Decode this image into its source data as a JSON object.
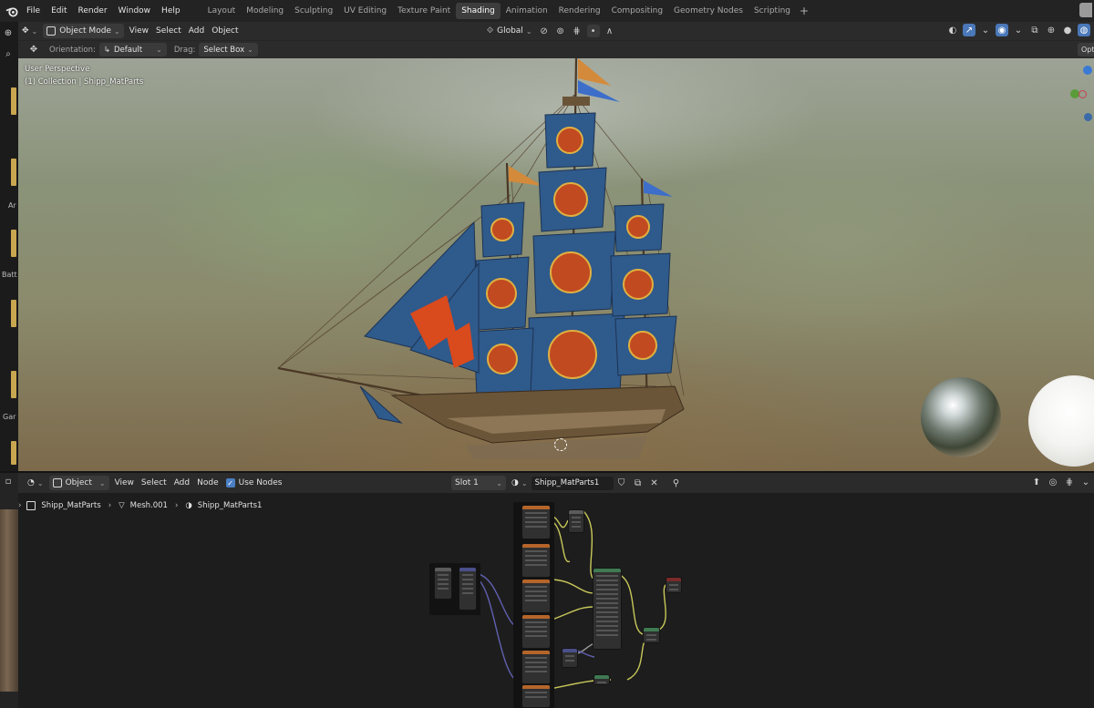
{
  "topbar": {
    "menus": [
      "File",
      "Edit",
      "Render",
      "Window",
      "Help"
    ],
    "workspaces": [
      "Layout",
      "Modeling",
      "Sculpting",
      "UV Editing",
      "Texture Paint",
      "Shading",
      "Animation",
      "Rendering",
      "Compositing",
      "Geometry Nodes",
      "Scripting"
    ],
    "active_workspace": "Shading",
    "add_tab": "+"
  },
  "viewport_header": {
    "mode": "Object Mode",
    "menus": [
      "View",
      "Select",
      "Add",
      "Object"
    ],
    "transform_orientation": "Global"
  },
  "tool_settings": {
    "orientation_label": "Orientation:",
    "orientation_value": "Default",
    "drag_label": "Drag:",
    "drag_value": "Select Box",
    "options_label": "Opt"
  },
  "viewport": {
    "perspective": "User Perspective",
    "collection_info": "(1) Collection | Shipp_MatParts"
  },
  "left_toolbar": {
    "labels": [
      "Ar",
      "Batt",
      "Gar"
    ]
  },
  "node_editor": {
    "object_dropdown": "Object",
    "menus": [
      "View",
      "Select",
      "Add",
      "Node"
    ],
    "use_nodes_label": "Use Nodes",
    "use_nodes_checked": true,
    "slot": "Slot 1",
    "material": "Shipp_MatParts1",
    "breadcrumb": [
      "Shipp_MatParts",
      "Mesh.001",
      "Shipp_MatParts1"
    ]
  },
  "colors": {
    "accent_blue": "#4a7fc4",
    "active_tab_bg": "#3d3d3d",
    "node_header_green": "#3f7a52",
    "node_header_orange": "#b5652a"
  }
}
